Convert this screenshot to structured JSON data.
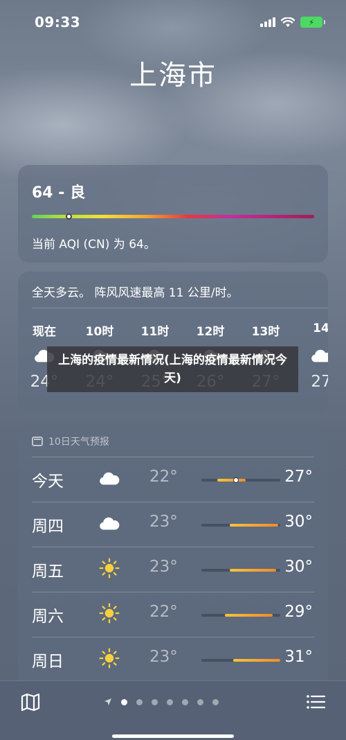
{
  "status": {
    "time": "09:33"
  },
  "city": "上海市",
  "aqi": {
    "title": "64 - 良",
    "level": 0.13,
    "description": "当前 AQI (CN) 为 64。"
  },
  "hourly": {
    "summary": "全天多云。 阵风风速最高 11 公里/时。",
    "hours": [
      {
        "label": "现在",
        "icon": "cloud-icon",
        "temp": "24°"
      },
      {
        "label": "10时",
        "icon": "cloud-icon",
        "temp": "24°"
      },
      {
        "label": "11时",
        "icon": "cloud-icon",
        "temp": "25°"
      },
      {
        "label": "12时",
        "icon": "cloud-icon",
        "temp": "26°"
      },
      {
        "label": "13时",
        "icon": "cloud-icon",
        "temp": "27°"
      },
      {
        "label": "14",
        "icon": "cloud-icon",
        "temp": "27"
      }
    ]
  },
  "overlay": {
    "text": "上海的疫情最新情况(上海的疫情最新情况今天)"
  },
  "daily": {
    "header": "10日天气预报",
    "days": [
      {
        "name": "今天",
        "icon": "cloud-icon",
        "low": "22°",
        "high": "27°",
        "range_start": 0.2,
        "range_end": 0.56,
        "current": 0.44
      },
      {
        "name": "周四",
        "icon": "cloud-icon",
        "low": "23°",
        "high": "30°",
        "range_start": 0.36,
        "range_end": 0.97
      },
      {
        "name": "周五",
        "icon": "sun-icon",
        "low": "23°",
        "high": "30°",
        "range_start": 0.36,
        "range_end": 0.95
      },
      {
        "name": "周六",
        "icon": "sun-icon",
        "low": "22°",
        "high": "29°",
        "range_start": 0.3,
        "range_end": 0.9
      },
      {
        "name": "周日",
        "icon": "sun-icon",
        "low": "23°",
        "high": "31°",
        "range_start": 0.4,
        "range_end": 1.0
      }
    ]
  },
  "pager": {
    "pages": 8,
    "active": 1
  }
}
